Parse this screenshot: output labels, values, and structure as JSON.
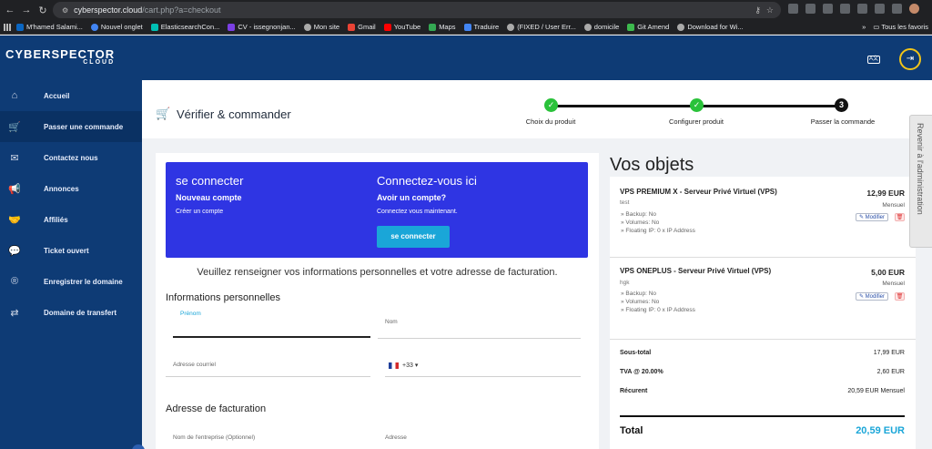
{
  "browser": {
    "url_host": "cyberspector.cloud",
    "url_path": "/cart.php?a=checkout",
    "bookmarks": [
      "M'hamed Salami...",
      "Nouvel onglet",
      "ElasticsearchCon...",
      "CV - issegnonjan...",
      "Mon site",
      "Gmail",
      "YouTube",
      "Maps",
      "Traduire",
      "(FIXED / User Err...",
      "domicile",
      "Git Amend",
      "Download for Wi..."
    ],
    "bookmarks_more": "»",
    "all_bookmarks": "Tous les favoris"
  },
  "header": {
    "logo_main": "CYBERSPECTOR",
    "logo_sub": "CLOUD",
    "lang_label": "A文"
  },
  "sidebar": {
    "items": [
      {
        "label": "Accueil",
        "icon": "home-icon",
        "glyph": "⌂"
      },
      {
        "label": "Passer une commande",
        "icon": "cart-icon",
        "glyph": "🛒"
      },
      {
        "label": "Contactez nous",
        "icon": "mail-icon",
        "glyph": "✉"
      },
      {
        "label": "Annonces",
        "icon": "megaphone-icon",
        "glyph": "📢"
      },
      {
        "label": "Affiliés",
        "icon": "handshake-icon",
        "glyph": "🤝"
      },
      {
        "label": "Ticket ouvert",
        "icon": "chat-icon",
        "glyph": "💬"
      },
      {
        "label": "Enregistrer le domaine",
        "icon": "registered-icon",
        "glyph": "®"
      },
      {
        "label": "Domaine de transfert",
        "icon": "transfer-icon",
        "glyph": "⇄"
      }
    ]
  },
  "page": {
    "title": "Vérifier & commander",
    "steps": [
      {
        "label": "Choix du produit",
        "state": "done"
      },
      {
        "label": "Configurer produit",
        "state": "done"
      },
      {
        "label": "Passer la commande",
        "state": "current",
        "number": "3"
      }
    ]
  },
  "login": {
    "left_title": "se connecter",
    "left_sub": "Nouveau compte",
    "left_text": "Créer un compte",
    "right_title": "Connectez-vous ici",
    "right_sub": "Avoir un compte?",
    "right_text": "Connectez vous maintenant.",
    "button": "se connecter",
    "banner_color": "#2f35e3"
  },
  "form": {
    "intro": "Veuillez renseigner vos informations personnelles et votre adresse de facturation.",
    "personal_heading": "Informations personnelles",
    "firstname_label": "Prénom",
    "lastname_label": "Nom",
    "email_label": "Adresse courriel",
    "phone_code": "+33",
    "billing_heading": "Adresse de facturation",
    "company_label": "Nom de l'entreprise (Optionnel)",
    "address_label": "Adresse"
  },
  "cart": {
    "heading": "Vos objets",
    "items": [
      {
        "name": "VPS PREMIUM X - Serveur Privé Virtuel (VPS)",
        "price": "12,99 EUR",
        "desc": "test",
        "cycle": "Mensuel",
        "options": [
          "» Backup: No",
          "» Volumes: No",
          "» Floating IP: 0 x IP Address"
        ],
        "edit": "Modifier"
      },
      {
        "name": "VPS ONEPLUS - Serveur Privé Virtuel (VPS)",
        "price": "5,00 EUR",
        "desc": "hgk",
        "cycle": "Mensuel",
        "options": [
          "» Backup: No",
          "» Volumes: No",
          "» Floating IP: 0 x IP Address"
        ],
        "edit": "Modifier"
      }
    ],
    "subtotal_label": "Sous-total",
    "subtotal": "17,99 EUR",
    "tax_label": "TVA @ 20.00%",
    "tax": "2,60 EUR",
    "recurring_label": "Récurent",
    "recurring": "20,59 EUR Mensuel",
    "total_label": "Total",
    "total": "20,59 EUR",
    "accent_color": "#1aa6d8"
  },
  "admin_tab": "Revenir à l'administration"
}
